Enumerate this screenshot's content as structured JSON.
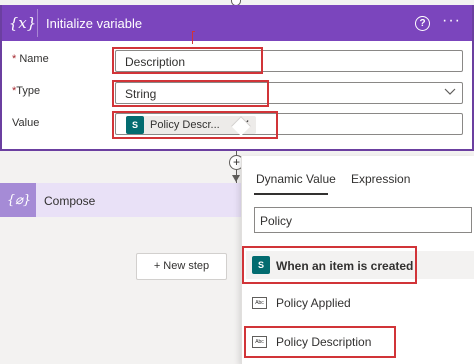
{
  "init_variable": {
    "icon": "{x}",
    "title": "Initialize variable",
    "help": "?",
    "more": "···",
    "name_label": "Name",
    "type_label": "Type",
    "value_label": "Value",
    "required_mark": "*",
    "name_value": "Description",
    "type_value": "String",
    "value_token": "Policy Descr...",
    "token_remove": "✕",
    "sharepoint_glyph": "S"
  },
  "compose": {
    "icon": "{⌀}",
    "title": "Compose"
  },
  "plus": "+",
  "new_step": "+ New step",
  "panel": {
    "tabs": [
      "Dynamic Value",
      "Expression"
    ],
    "search_value": "Policy",
    "section_title": "When an item is created",
    "items": [
      "Policy Applied",
      "Policy Description"
    ],
    "item_icon_text": "Abc"
  },
  "colors": {
    "header_purple": "#7b45bd",
    "compose_bg": "#e9e1f7",
    "sharepoint_teal": "#036c70",
    "highlight_red": "#d13438"
  }
}
